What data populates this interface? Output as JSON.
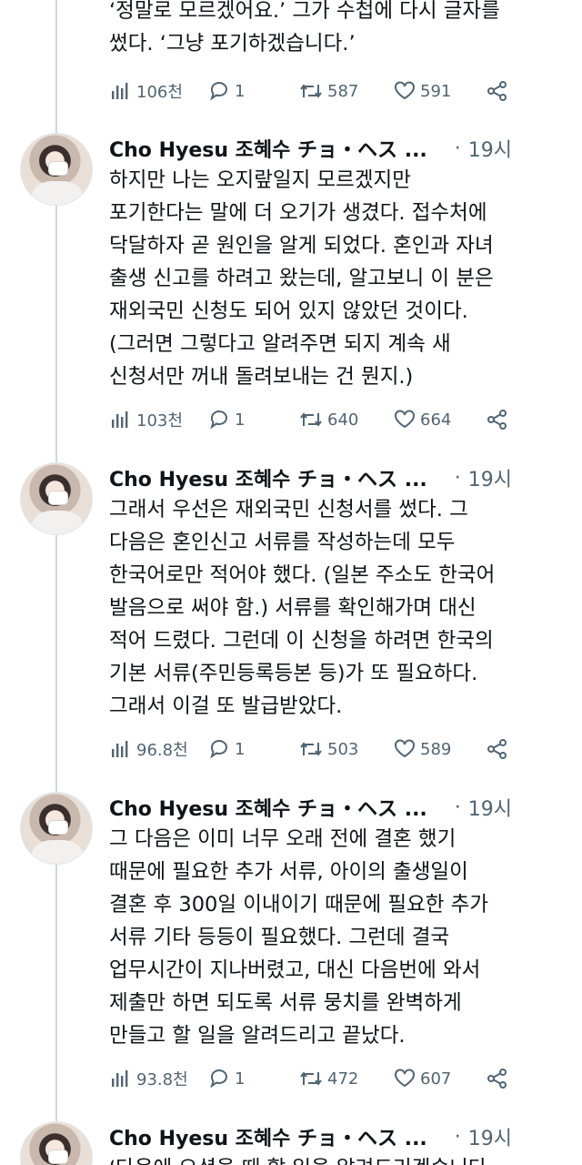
{
  "top_tweet": {
    "text": "‘정말로 모르겠어요.’ 그가 수첩에 다시 글자를\n썼다. ‘그냥 포기하겠습니다.’",
    "views": "106천",
    "replies": "1",
    "retweets": "587",
    "likes": "591"
  },
  "tweets": [
    {
      "author": "Cho Hyesu 조혜수 チョ・ヘス ...",
      "time": "19시",
      "text": "하지만 나는 오지랖일지 모르겠지만\n포기한다는 말에 더 오기가 생겼다. 접수처에\n닥달하자 곧 원인을 알게 되었다. 혼인과 자녀\n출생 신고를 하려고 왔는데, 알고보니 이 분은\n재외국민 신청도 되어 있지 않았던 것이다.\n(그러면 그렇다고 알려주면 되지 계속 새\n신청서만 꺼내 돌려보내는 건 뭔지.)",
      "views": "103천",
      "replies": "1",
      "retweets": "640",
      "likes": "664"
    },
    {
      "author": "Cho Hyesu 조혜수 チョ・ヘス ...",
      "time": "19시",
      "text": "그래서 우선은 재외국민 신청서를 썼다. 그\n다음은 혼인신고 서류를 작성하는데 모두\n한국어로만 적어야 했다. (일본 주소도 한국어\n발음으로 써야 함.) 서류를 확인해가며 대신\n적어 드렸다. 그런데 이 신청을 하려면 한국의\n기본 서류(주민등록등본 등)가 또 필요하다.\n그래서 이걸 또 발급받았다.",
      "views": "96.8천",
      "replies": "1",
      "retweets": "503",
      "likes": "589"
    },
    {
      "author": "Cho Hyesu 조혜수 チョ・ヘス ...",
      "time": "19시",
      "text": "그 다음은 이미 너무 오래 전에 결혼 했기\n때문에 필요한 추가 서류, 아이의 출생일이\n결혼 후 300일 이내이기 때문에 필요한 추가\n서류 기타 등등이 필요했다. 그런데 결국\n업무시간이 지나버렸고, 대신 다음번에 와서\n제출만 하면 되도록 서류 뭉치를 완벽하게\n만들고 할 일을 알려드리고 끝났다.",
      "views": "93.8천",
      "replies": "1",
      "retweets": "472",
      "likes": "607"
    },
    {
      "author": "Cho Hyesu 조혜수 チョ・ヘス ...",
      "time": "19시",
      "text": "‘다음에 오셨을 때 할 일을 알려드리겠습니다"
    }
  ],
  "icons": {
    "views": "bar-chart-icon",
    "reply": "comment-bubble-icon",
    "retweet": "retweet-arrows-icon",
    "like": "heart-icon",
    "share": "share-icon",
    "more": "more-dots-icon"
  },
  "colors": {
    "text": "#0f1419",
    "muted": "#536471",
    "thread_line": "#cfd9de"
  }
}
